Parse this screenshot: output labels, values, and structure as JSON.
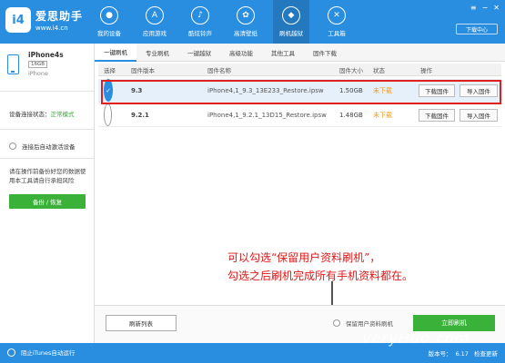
{
  "app": {
    "name": "爱思助手",
    "url": "www.i4.cn",
    "logo_mark": "i4"
  },
  "nav": [
    {
      "label": "我的设备",
      "icon": "apple-icon"
    },
    {
      "label": "应用游戏",
      "icon": "app-store-icon"
    },
    {
      "label": "酷炫铃声",
      "icon": "bell-icon"
    },
    {
      "label": "高清壁纸",
      "icon": "flower-icon"
    },
    {
      "label": "刷机越狱",
      "icon": "dropbox-icon"
    },
    {
      "label": "工具箱",
      "icon": "tools-icon"
    }
  ],
  "window": {
    "download_center": "下载中心"
  },
  "device": {
    "name": "iPhone4s",
    "capacity": "16GB",
    "type": "iPhone"
  },
  "sidebar": {
    "conn_label": "设备连接状态：",
    "conn_value": "正常模式",
    "auto_activate": "连接后自动激活设备",
    "hint": "请在操作前备份好您的数据使用本工具请自行承担风险",
    "backup_button": "备份 / 恢复"
  },
  "tabs": [
    "一键刷机",
    "专业刷机",
    "一键越狱",
    "高级功能",
    "其他工具",
    "固件下载"
  ],
  "table": {
    "headers": {
      "select": "选择",
      "version": "固件版本",
      "name": "固件名称",
      "size": "固件大小",
      "state": "状态",
      "ops": "操作"
    },
    "rows": [
      {
        "version": "9.3",
        "name": "iPhone4,1_9.3_13E233_Restore.ipsw",
        "size": "1.50GB",
        "state": "未下载",
        "selected": true
      },
      {
        "version": "9.2.1",
        "name": "iPhone4,1_9.2.1_13D15_Restore.ipsw",
        "size": "1.48GB",
        "state": "未下载",
        "selected": false
      }
    ],
    "download_button": "下载固件",
    "import_button": "导入固件"
  },
  "annotation": {
    "line1": "可以勾选“保留用户资料刷机”，",
    "line2": "勾选之后刷机完成所有手机资料都在。"
  },
  "footer": {
    "refresh_button": "刷新列表",
    "keep_data": "保留用户资料刷机",
    "flash_button": "立即刷机"
  },
  "statusbar": {
    "block_itunes": "阻止iTunes自动运行",
    "version_label": "版本号：",
    "version": "6.17",
    "update": "检查更新"
  },
  "watermark": "VeryHuo.com",
  "colors": {
    "primary": "#2a8ee0",
    "green": "#3ab23a",
    "red": "#e02020",
    "orange": "#f09a1a"
  }
}
